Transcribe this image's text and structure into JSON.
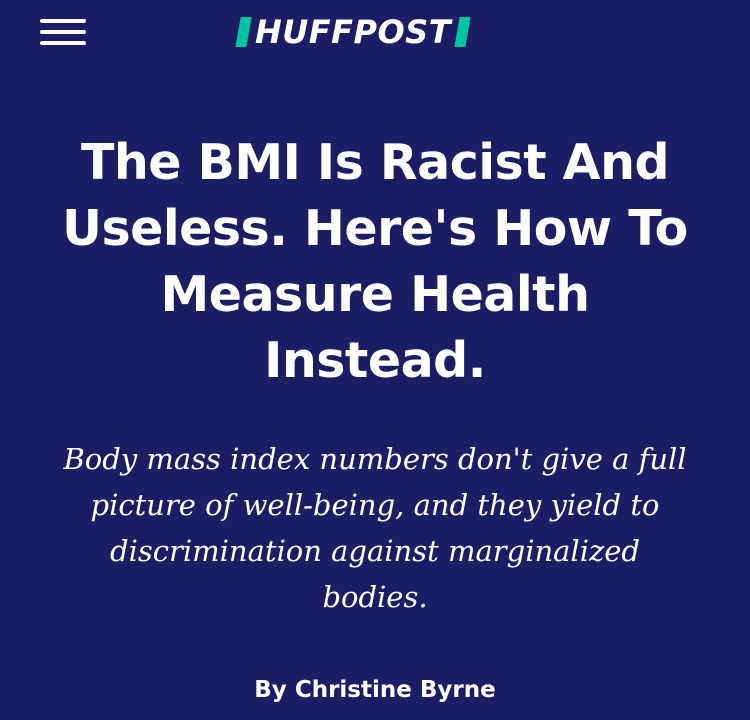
{
  "header": {
    "logo_text": "HUFFPOST",
    "logo_icon": "huffpost-logo",
    "menu_icon": "hamburger-menu-icon"
  },
  "article": {
    "headline": "The BMI Is Racist And Useless. Here's How To Measure Health Instead.",
    "dek": "Body mass index numbers don't give a full picture of well-being, and they yield to discrimination against marginalized bodies.",
    "byline_prefix": "By",
    "author": "Christine Byrne"
  },
  "colors": {
    "background": "#1b1e65",
    "text": "#ffffff",
    "logo_accent": "#00c4a0"
  }
}
